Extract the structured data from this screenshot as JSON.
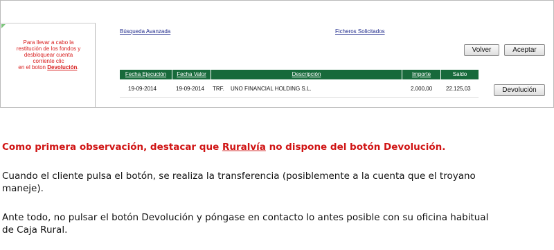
{
  "top_panel": {
    "notice": {
      "line1": "Para llevar a cabo la",
      "line2": "restitución de los fondos y",
      "line3": "desbloquear cuenta",
      "line4": "corriente clic",
      "line5_prefix": "en el boton ",
      "line5_bold": "Devolución",
      "line5_suffix": "."
    },
    "links": {
      "busqueda": "Búsqueda Avanzada",
      "ficheros": "Ficheros Solicitados"
    },
    "buttons": {
      "volver": "Volver",
      "aceptar": "Aceptar",
      "devolucion": "Devolución"
    },
    "table": {
      "headers": [
        "Fecha Ejecución",
        "Fecha Valor",
        "Descripción",
        "Importe",
        "Saldo"
      ],
      "rows": [
        {
          "fecha_ejecucion": "19-09-2014",
          "fecha_valor": "19-09-2014",
          "descripcion_tipo": "TRF.",
          "descripcion": "UNO FINANCIAL HOLDING S.L.",
          "importe": "2.000,00",
          "saldo": "22.125,03"
        }
      ]
    }
  },
  "article": {
    "observation_prefix": "Como primera observación, destacar que ",
    "observation_underlined": "Ruralvía",
    "observation_suffix": " no dispone del botón Devolución.",
    "paragraph2_line1": "Cuando el cliente pulsa el botón, se realiza la transferencia (posiblemente a la cuenta que el troyano",
    "paragraph2_line2": "maneje).",
    "paragraph3_line1": "Ante todo, no pulsar el botón Devolución y póngase en contacto lo antes posible con su oficina habitual",
    "paragraph3_line2": "de Caja Rural."
  }
}
